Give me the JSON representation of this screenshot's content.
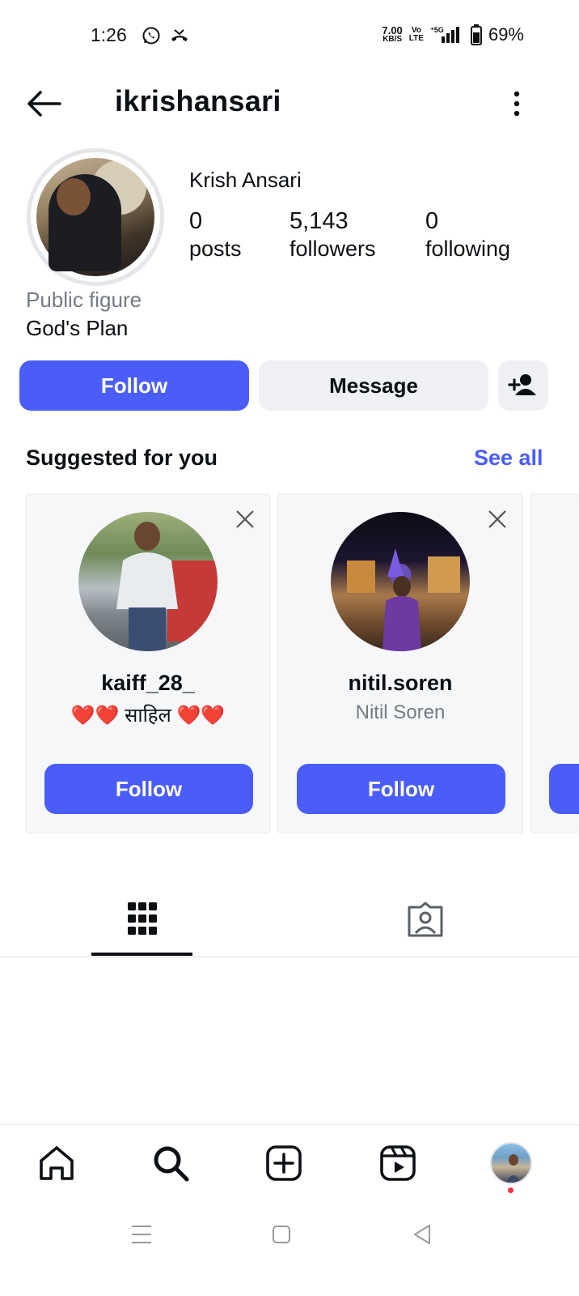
{
  "status_bar": {
    "time": "1:26",
    "net_speed": "7.00",
    "net_unit": "KB/S",
    "volte_top": "Vo",
    "volte_bottom": "LTE",
    "network": "5G",
    "battery": "69%",
    "icons": [
      "whatsapp-icon",
      "missed-call-icon",
      "signal-icon",
      "battery-icon"
    ]
  },
  "header": {
    "username": "ikrishansari",
    "back_icon": "arrow-left-icon",
    "more_icon": "more-vertical-icon"
  },
  "profile": {
    "full_name": "Krish Ansari",
    "stats": [
      {
        "value": "0",
        "label": "posts"
      },
      {
        "value": "5,143",
        "label": "followers"
      },
      {
        "value": "0",
        "label": "following"
      }
    ],
    "category": "Public figure",
    "bio": "God's Plan"
  },
  "actions": {
    "follow_label": "Follow",
    "message_label": "Message",
    "add_user_icon": "person-add-icon"
  },
  "suggested": {
    "title": "Suggested for you",
    "see_all": "See all",
    "cards": [
      {
        "username": "kaiff_28_",
        "subtitle": "❤️❤️ साहिल ❤️❤️",
        "button": "Follow"
      },
      {
        "username": "nitil.soren",
        "subtitle": "Nitil Soren",
        "button": "Follow"
      }
    ]
  },
  "tabs": [
    "grid-icon",
    "tagged-icon"
  ],
  "bottom_nav": [
    "home-icon",
    "search-icon",
    "create-icon",
    "reels-icon",
    "profile-avatar"
  ],
  "system_nav": [
    "menu-icon",
    "home-square-icon",
    "back-triangle-icon"
  ],
  "colors": {
    "accent": "#4a5df9",
    "secondary_button": "#eff0f4",
    "muted_text": "#737b85",
    "notification_dot": "#ff3040"
  }
}
